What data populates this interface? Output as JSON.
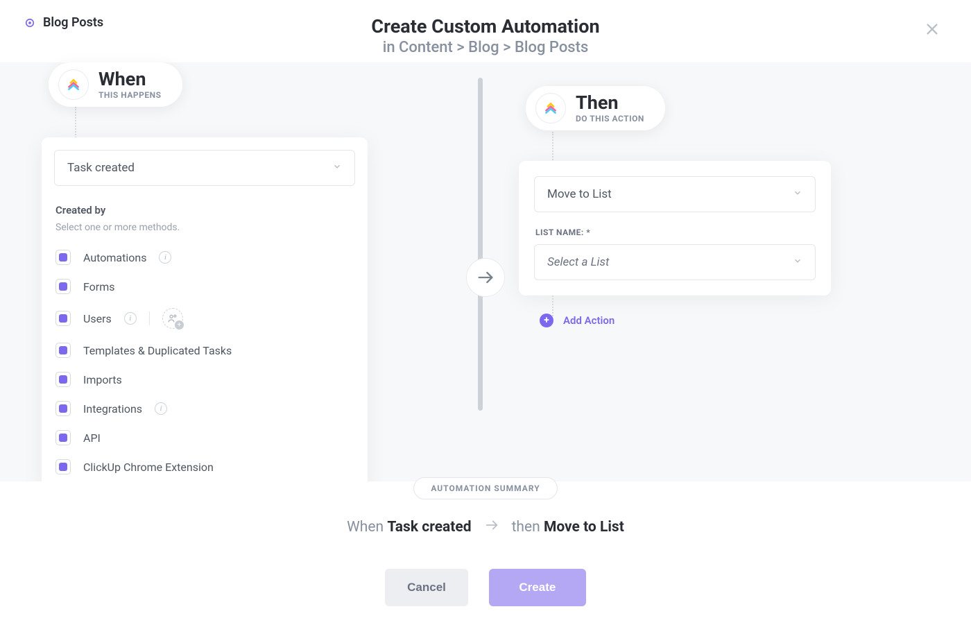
{
  "header": {
    "breadcrumb_label": "Blog Posts",
    "title": "Create Custom Automation",
    "subtitle": "in Content > Blog > Blog Posts"
  },
  "when": {
    "title": "When",
    "subtitle": "THIS HAPPENS",
    "trigger_selected": "Task created",
    "created_by_label": "Created by",
    "created_by_sub": "Select one or more methods.",
    "methods": [
      {
        "label": "Automations",
        "has_info": true
      },
      {
        "label": "Forms",
        "has_info": false
      },
      {
        "label": "Users",
        "has_info": true,
        "has_people": true
      },
      {
        "label": "Templates & Duplicated Tasks",
        "has_info": false
      },
      {
        "label": "Imports",
        "has_info": false
      },
      {
        "label": "Integrations",
        "has_info": true
      },
      {
        "label": "API",
        "has_info": false
      },
      {
        "label": "ClickUp Chrome Extension",
        "has_info": false
      }
    ]
  },
  "then": {
    "title": "Then",
    "subtitle": "DO THIS ACTION",
    "action_selected": "Move to List",
    "list_name_label": "LIST NAME: *",
    "list_placeholder": "Select a List",
    "add_action_label": "Add Action"
  },
  "footer": {
    "summary_pill": "AUTOMATION SUMMARY",
    "summary_when_prefix": "When",
    "summary_when_strong": "Task created",
    "summary_then_prefix": "then",
    "summary_then_strong": "Move to List",
    "cancel_label": "Cancel",
    "create_label": "Create"
  }
}
